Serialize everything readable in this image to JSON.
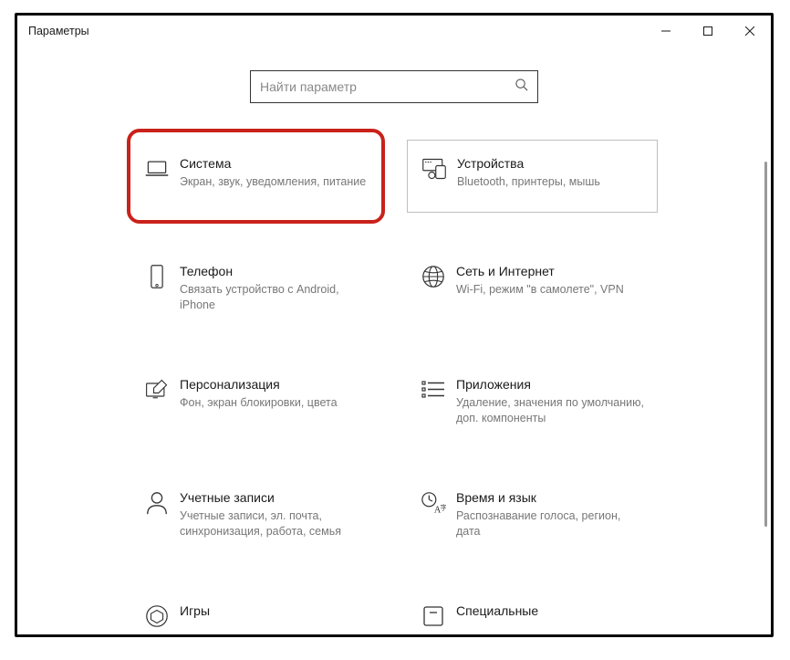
{
  "window": {
    "title": "Параметры"
  },
  "search": {
    "placeholder": "Найти параметр"
  },
  "tiles": {
    "system": {
      "title": "Система",
      "desc": "Экран, звук, уведомления, питание"
    },
    "devices": {
      "title": "Устройства",
      "desc": "Bluetooth, принтеры, мышь"
    },
    "phone": {
      "title": "Телефон",
      "desc": "Связать устройство с Android, iPhone"
    },
    "network": {
      "title": "Сеть и Интернет",
      "desc": "Wi-Fi, режим \"в самолете\", VPN"
    },
    "personalize": {
      "title": "Персонализация",
      "desc": "Фон, экран блокировки, цвета"
    },
    "apps": {
      "title": "Приложения",
      "desc": "Удаление, значения по умолчанию, доп. компоненты"
    },
    "accounts": {
      "title": "Учетные записи",
      "desc": "Учетные записи, эл. почта, синхронизация, работа, семья"
    },
    "time": {
      "title": "Время и язык",
      "desc": "Распознавание голоса, регион, дата"
    },
    "gaming": {
      "title": "Игры",
      "desc": ""
    },
    "ease": {
      "title": "Специальные",
      "desc": ""
    }
  }
}
